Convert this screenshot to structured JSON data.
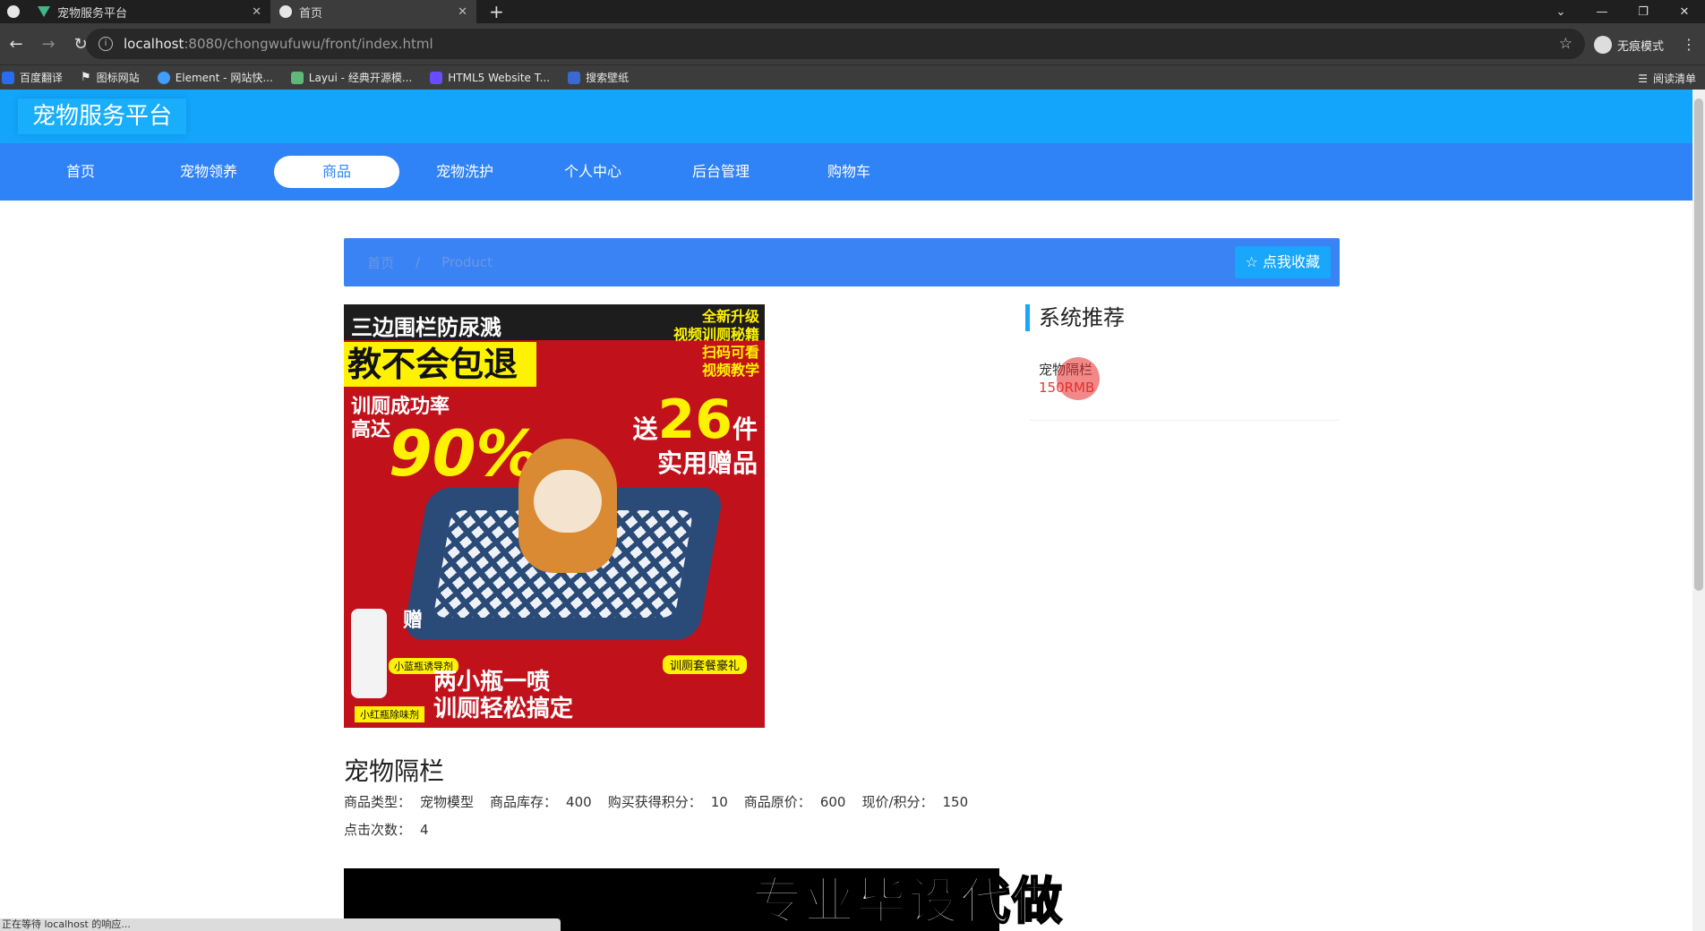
{
  "browser": {
    "tabs": [
      {
        "title": "宠物服务平台",
        "icon": "vue-icon",
        "active": false
      },
      {
        "title": "首页",
        "icon": "globe-icon",
        "active": true
      }
    ],
    "new_tab": "+",
    "window_controls": [
      "⌄",
      "—",
      "❐",
      "✕"
    ],
    "url_host": "localhost",
    "url_path": ":8080/chongwufuwu/front/index.html",
    "incognito_label": "无痕模式",
    "bookmarks": [
      {
        "label": "百度翻译",
        "color": "#2a6cf0"
      },
      {
        "label": "图标网站",
        "color": "#222222"
      },
      {
        "label": "Element - 网站快...",
        "color": "#409eff"
      },
      {
        "label": "Layui - 经典开源模...",
        "color": "#5fb878"
      },
      {
        "label": "HTML5 Website T...",
        "color": "#6a4cff"
      },
      {
        "label": "搜索壁纸",
        "color": "#3a6ad0"
      }
    ],
    "reading_list": "阅读清单",
    "status_text": "正在等待 localhost 的响应..."
  },
  "site": {
    "title": "宠物服务平台",
    "nav": [
      {
        "label": "首页",
        "active": false
      },
      {
        "label": "宠物领养",
        "active": false
      },
      {
        "label": "商品",
        "active": true
      },
      {
        "label": "宠物洗护",
        "active": false
      },
      {
        "label": "个人中心",
        "active": false
      },
      {
        "label": "后台管理",
        "active": false
      },
      {
        "label": "购物车",
        "active": false
      }
    ],
    "colors": {
      "header": "#12a5fb",
      "nav": "#2f83f6",
      "accent": "#18a7fb",
      "price": "#e53935"
    }
  },
  "breadcrumb": {
    "home": "首页",
    "separator": "/",
    "current": "Product",
    "fav_button": "点我收藏",
    "fav_icon": "star-icon"
  },
  "product": {
    "image_text": {
      "top": "三边围栏防尿溅",
      "yellow": "教不会包退",
      "side1": "全新升级",
      "side2": "视频训厕秘籍",
      "side3": "扫码可看",
      "side4": "视频教学",
      "rate1": "训厕成功率",
      "rate2": "高达",
      "rate_value": "90%",
      "gift_pre": "送",
      "gift_num": "26",
      "gift_unit": "件",
      "gift_line2": "实用赠品",
      "gift_small": "赠",
      "tag1": "小蓝瓶诱导剂",
      "tag2": "训厕套餐豪礼",
      "tag3": "小红瓶除味剂",
      "bottom1": "两小瓶一喷",
      "bottom2": "训厕轻松搞定"
    },
    "name": "宠物隔栏",
    "attrs": [
      {
        "label": "商品类型：",
        "value": "宠物模型"
      },
      {
        "label": "商品库存：",
        "value": "400"
      },
      {
        "label": "购买获得积分：",
        "value": "10"
      },
      {
        "label": "商品原价：",
        "value": "600"
      },
      {
        "label": "现价/积分：",
        "value": "150"
      }
    ],
    "clicks_label": "点击次数：",
    "clicks_value": "4"
  },
  "recommend": {
    "title": "系统推荐",
    "items": [
      {
        "name": "宠物隔栏",
        "price": "150RMB"
      }
    ]
  },
  "overlay_watermark": "专业毕设代做"
}
